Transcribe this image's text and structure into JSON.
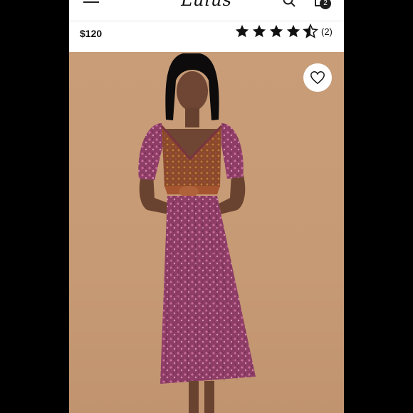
{
  "header": {
    "logo_text": "Lulus",
    "cart_count": "2",
    "icons": [
      "menu-icon",
      "search-icon",
      "cart-icon"
    ]
  },
  "product": {
    "price": "$120",
    "rating": 4.5,
    "rating_max": 5,
    "review_count": "(2)"
  },
  "colors": {
    "background": "#c99d78",
    "dress": "#8e3d67",
    "bodice": "#8a4a2a"
  },
  "wishlist": {
    "icon": "heart-icon"
  }
}
